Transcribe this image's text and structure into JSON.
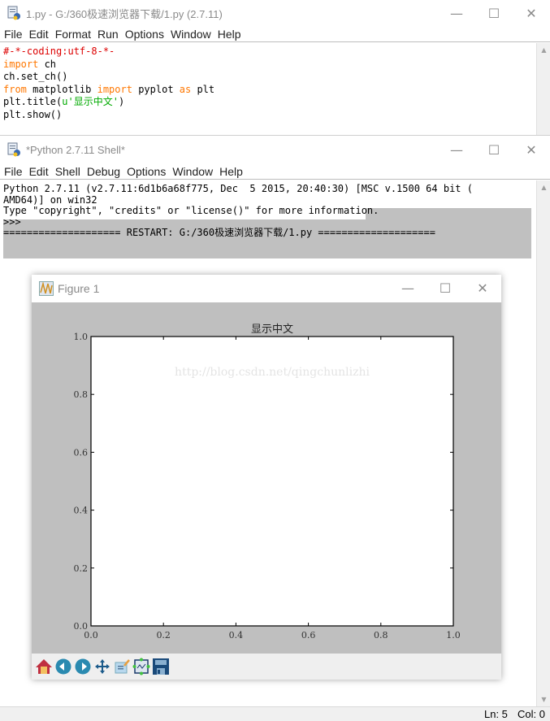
{
  "editor": {
    "title": "1.py - G:/360极速浏览器下载/1.py (2.7.11)",
    "menu": [
      "File",
      "Edit",
      "Format",
      "Run",
      "Options",
      "Window",
      "Help"
    ],
    "code": {
      "line1": "#-*-coding:utf-8-*-",
      "line2_kw": "import",
      "line2_rest": " ch",
      "line3": "ch.set_ch()",
      "line4_kw1": "from",
      "line4_mid": " matplotlib ",
      "line4_kw2": "import",
      "line4_mid2": " pyplot ",
      "line4_kw3": "as",
      "line4_end": " plt",
      "line5_a": "plt.title(",
      "line5_str": "u'显示中文'",
      "line5_b": ")",
      "line6": "plt.show()"
    }
  },
  "shell": {
    "title": "*Python 2.7.11 Shell*",
    "menu": [
      "File",
      "Edit",
      "Shell",
      "Debug",
      "Options",
      "Window",
      "Help"
    ],
    "lines": [
      "Python 2.7.11 (v2.7.11:6d1b6a68f775, Dec  5 2015, 20:40:30) [MSC v.1500 64 bit (",
      "AMD64)] on win32",
      "Type \"copyright\", \"credits\" or \"license()\" for more information.",
      ">>> ",
      "==================== RESTART: G:/360极速浏览器下载/1.py ===================="
    ],
    "status": {
      "ln": "Ln: 5",
      "col": "Col: 0"
    }
  },
  "figure": {
    "title": "Figure 1",
    "watermark": "http://blog.csdn.net/qingchunlizhi",
    "toolbar": [
      "home",
      "back",
      "forward",
      "pan",
      "subplots",
      "zoom",
      "save"
    ]
  },
  "window_controls": {
    "minimize": "—",
    "maximize": "☐",
    "close": "✕"
  },
  "chart_data": {
    "type": "line",
    "title": "显示中文",
    "xlabel": "",
    "ylabel": "",
    "xlim": [
      0.0,
      1.0
    ],
    "ylim": [
      0.0,
      1.0
    ],
    "xticks": [
      "0.0",
      "0.2",
      "0.4",
      "0.6",
      "0.8",
      "1.0"
    ],
    "yticks": [
      "0.0",
      "0.2",
      "0.4",
      "0.6",
      "0.8",
      "1.0"
    ],
    "series": [],
    "grid": false
  }
}
